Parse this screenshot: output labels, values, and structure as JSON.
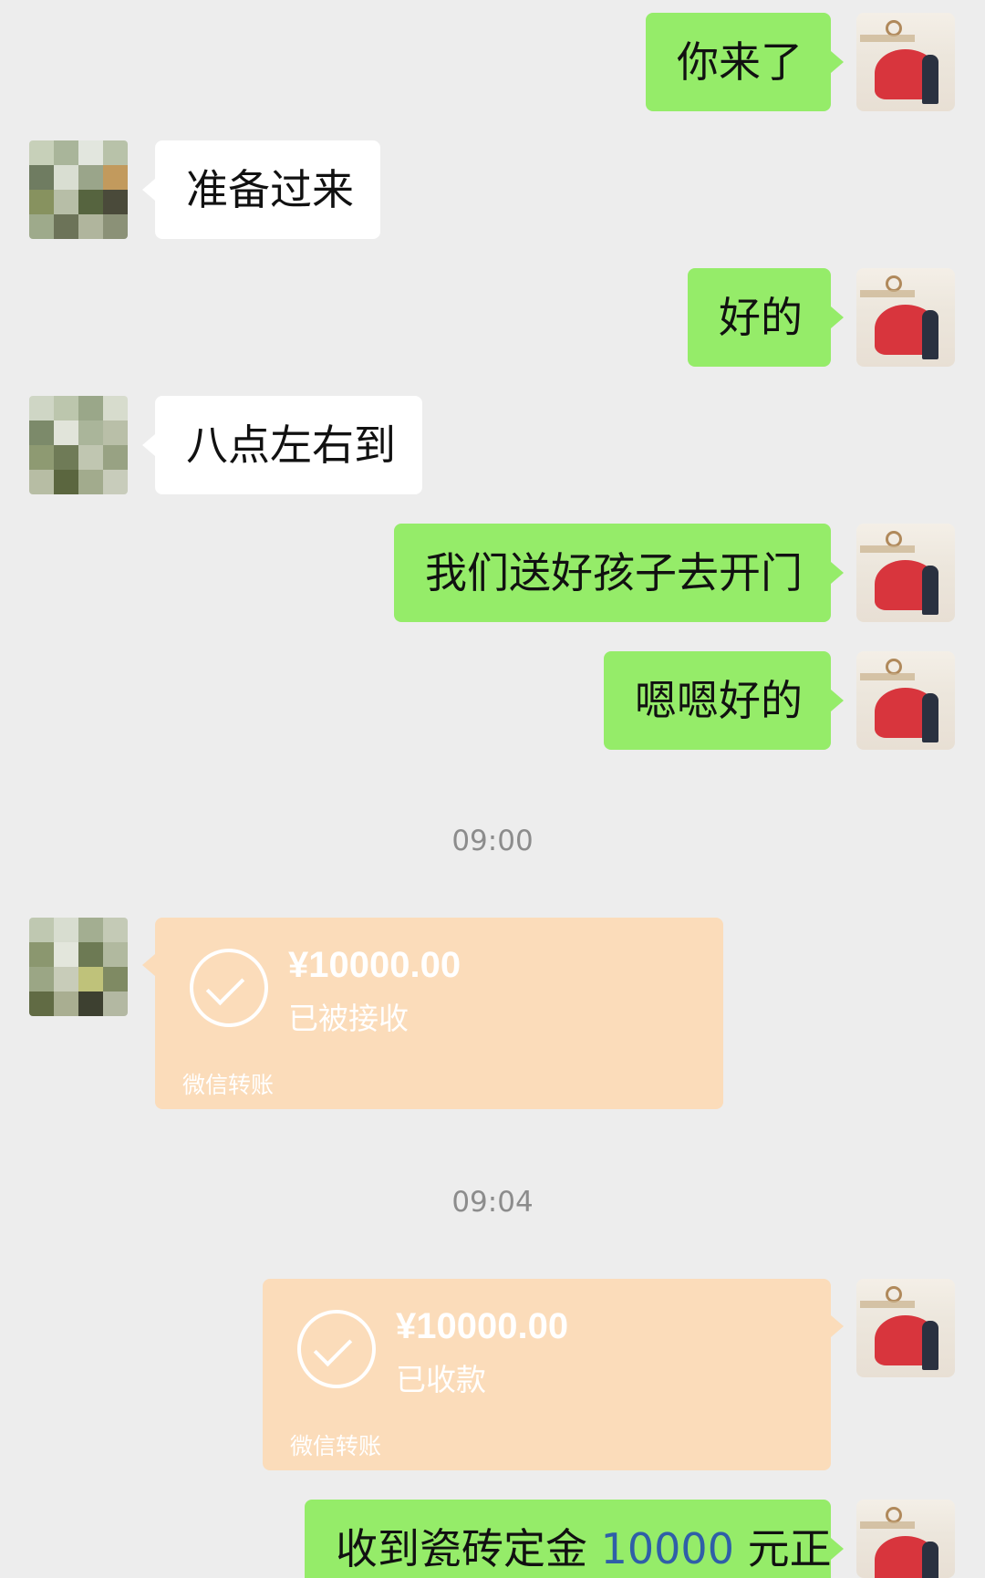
{
  "messages": [
    {
      "sender": "me",
      "text": "你来了"
    },
    {
      "sender": "other",
      "text": "准备过来"
    },
    {
      "sender": "me",
      "text": "好的"
    },
    {
      "sender": "other",
      "text": "八点左右到"
    },
    {
      "sender": "me",
      "text": "我们送好孩子去开门"
    },
    {
      "sender": "me",
      "text": "嗯嗯好的"
    }
  ],
  "timestamps": [
    "09:00",
    "09:04"
  ],
  "transfers": [
    {
      "sender": "other",
      "amount": "¥10000.00",
      "status": "已被接收",
      "brand": "微信转账"
    },
    {
      "sender": "me",
      "amount": "¥10000.00",
      "status": "已收款",
      "brand": "微信转账"
    }
  ],
  "last_message": {
    "sender": "me",
    "text_before": "收到瓷砖定金",
    "number": "10000",
    "text_after": "元正"
  },
  "colors": {
    "background": "#ededed",
    "my_bubble": "#95ec69",
    "other_bubble": "#ffffff",
    "transfer_card": "#fbdcba",
    "link_number": "#2f5fa8"
  }
}
